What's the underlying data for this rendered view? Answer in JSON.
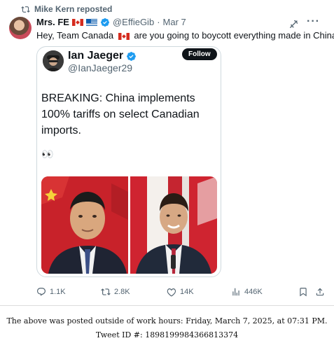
{
  "repost": {
    "text": "Mike Kern reposted"
  },
  "post": {
    "display_name": "Mrs. FE",
    "handle": "@EffieGib",
    "dot": "·",
    "date": "Mar 7",
    "text_part1": "Hey, Team Canada",
    "text_part2": "are you going to boycott everything made in China?"
  },
  "quote": {
    "display_name": "Ian Jaeger",
    "handle": "@IanJaeger29",
    "follow_label": "Follow",
    "body": "BREAKING: China implements 100% tariffs on select Canadian imports.",
    "emoji": "👀"
  },
  "actions": {
    "replies": "1.1K",
    "reposts": "2.8K",
    "likes": "14K",
    "views": "446K"
  },
  "footer": {
    "line1": "The above was posted outside of work hours: Friday, March 7, 2025, at 07:31 PM.",
    "line2": "Tweet ID #: 1898199984366813374"
  },
  "colors": {
    "verified": "#1d9bf0",
    "muted": "#536471",
    "text": "#0f1419"
  },
  "icons": [
    "repost-icon",
    "verified-badge-icon",
    "grok-icon",
    "more-icon",
    "reply-icon",
    "like-icon",
    "views-icon",
    "bookmark-icon",
    "share-icon"
  ]
}
